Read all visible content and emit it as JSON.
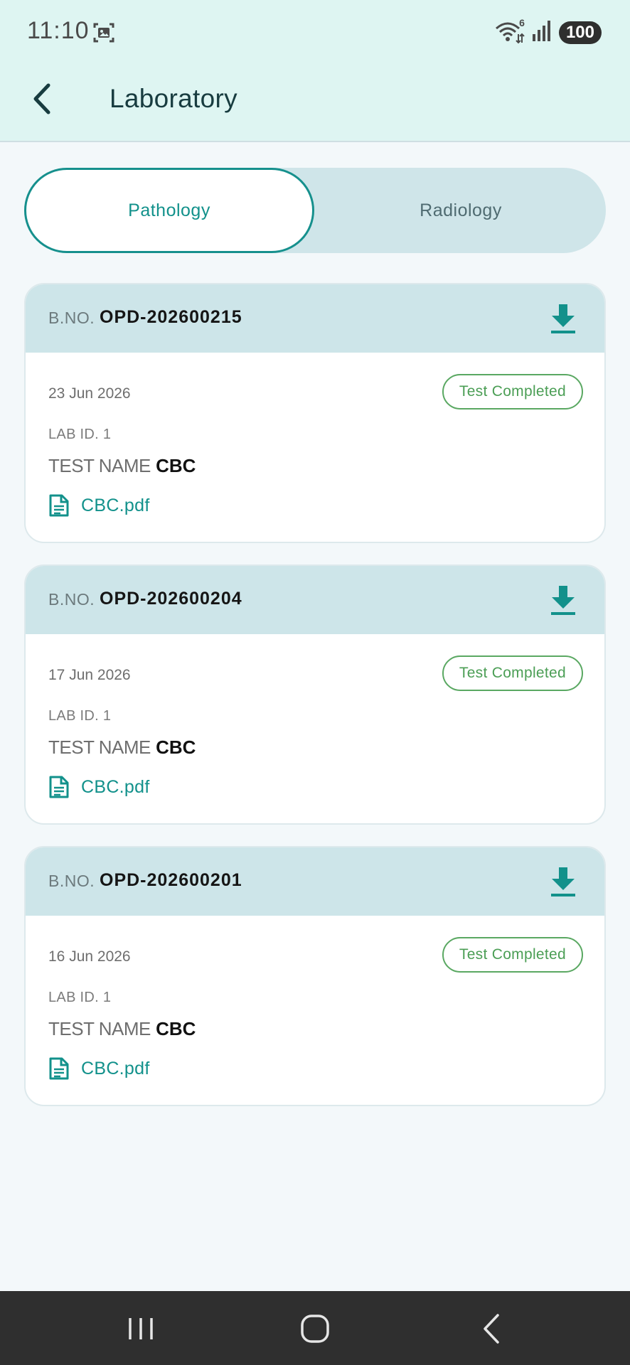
{
  "status_bar": {
    "time": "11:10",
    "wifi_badge": "6",
    "battery": "100"
  },
  "header": {
    "title": "Laboratory"
  },
  "tabs": [
    {
      "label": "Pathology",
      "selected": true
    },
    {
      "label": "Radiology",
      "selected": false
    }
  ],
  "colors": {
    "accent": "#12918b",
    "header_bg": "#def5f2",
    "card_head_bg": "#cde5e9",
    "status_green": "#4b9e55"
  },
  "reports": [
    {
      "bno_label": "B.NO.",
      "bno": "OPD-202600215",
      "date": "23 Jun 2026",
      "status": "Test Completed",
      "lab_id": "LAB ID. 1",
      "test_name_label": "TEST NAME",
      "test_name": "CBC",
      "file": "CBC.pdf"
    },
    {
      "bno_label": "B.NO.",
      "bno": "OPD-202600204",
      "date": "17 Jun 2026",
      "status": "Test Completed",
      "lab_id": "LAB ID. 1",
      "test_name_label": "TEST NAME",
      "test_name": "CBC",
      "file": "CBC.pdf"
    },
    {
      "bno_label": "B.NO.",
      "bno": "OPD-202600201",
      "date": "16 Jun 2026",
      "status": "Test Completed",
      "lab_id": "LAB ID. 1",
      "test_name_label": "TEST NAME",
      "test_name": "CBC",
      "file": "CBC.pdf"
    }
  ],
  "icons": {
    "back": "chevron-left-icon",
    "download": "download-icon",
    "file": "document-icon",
    "nav_recents": "recents-icon",
    "nav_home": "home-icon",
    "nav_back": "back-icon"
  }
}
